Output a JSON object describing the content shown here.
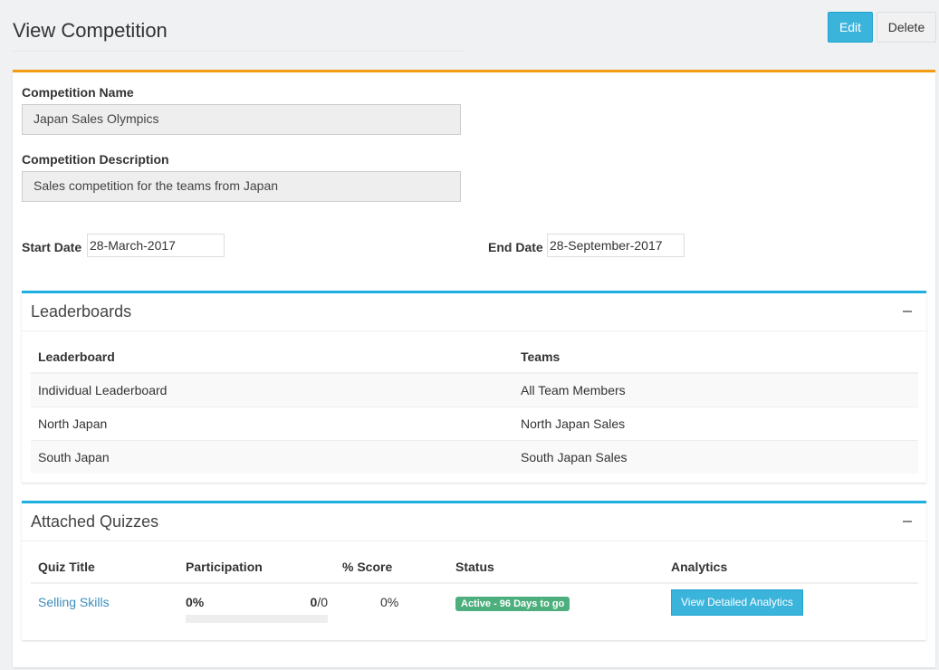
{
  "header": {
    "title": "View Competition",
    "edit_label": "Edit",
    "delete_label": "Delete"
  },
  "form": {
    "name_label": "Competition Name",
    "name_value": "Japan Sales Olympics",
    "desc_label": "Competition Description",
    "desc_value": "Sales competition for the teams from Japan",
    "start_label": "Start Date",
    "start_value": "28-March-2017",
    "end_label": "End Date",
    "end_value": "28-September-2017"
  },
  "leaderboards": {
    "title": "Leaderboards",
    "columns": [
      "Leaderboard",
      "Teams"
    ],
    "rows": [
      [
        "Individual Leaderboard",
        "All Team Members"
      ],
      [
        "North Japan",
        "North Japan Sales"
      ],
      [
        "South Japan",
        "South Japan Sales"
      ]
    ]
  },
  "quizzes": {
    "title": "Attached Quizzes",
    "columns": [
      "Quiz Title",
      "Participation",
      "% Score",
      "Status",
      "Analytics"
    ],
    "rows": [
      {
        "title": "Selling Skills",
        "participation_pct": "0%",
        "participation_count": "0",
        "participation_total": "0",
        "progress": 0,
        "score": "0%",
        "status": "Active - 96 Days to go",
        "analytics_label": "View Detailed Analytics"
      }
    ]
  },
  "colors": {
    "accent": "#3bb4dc",
    "panel_top": "#f39c12",
    "status": "#4caf7d"
  }
}
